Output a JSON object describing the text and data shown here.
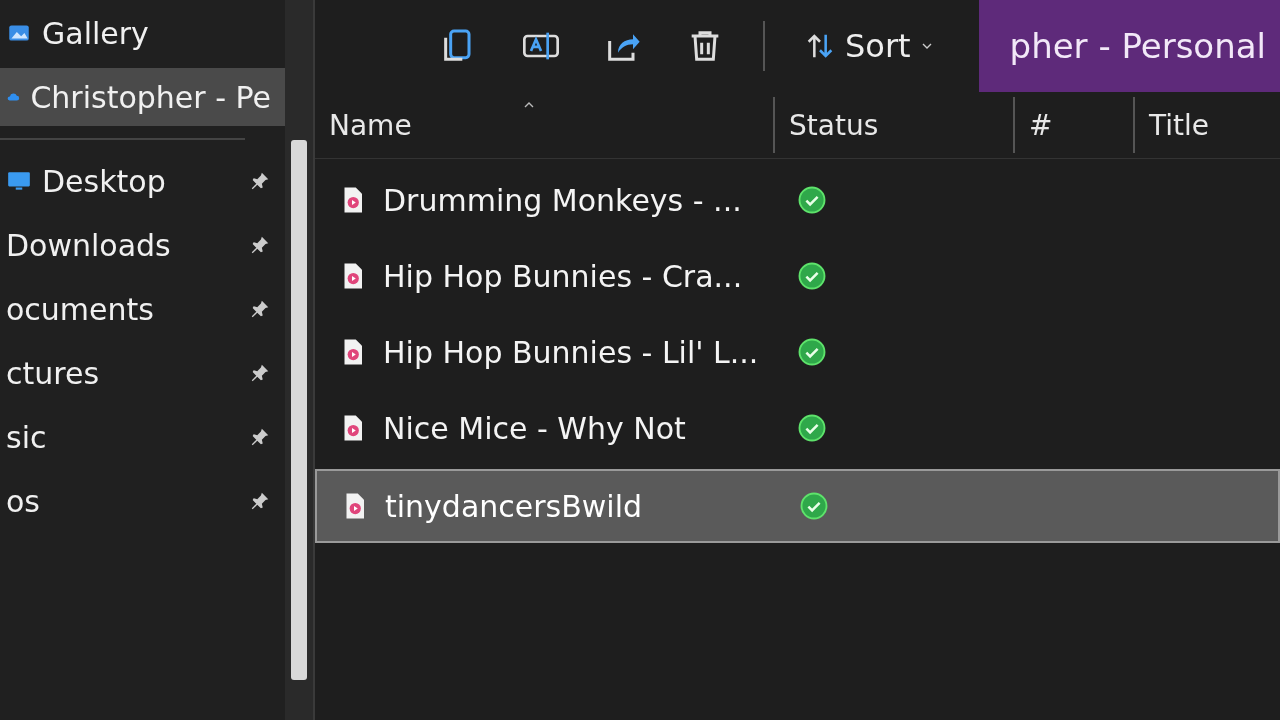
{
  "title_bar": {
    "title": "pher - Personal"
  },
  "sidebar": {
    "items": [
      {
        "label": "Gallery",
        "kind": "gallery",
        "pinned": false,
        "selected": false
      },
      {
        "label": "Christopher - Pe",
        "kind": "cloud",
        "pinned": false,
        "selected": true
      },
      {
        "kind": "separator"
      },
      {
        "label": "Desktop",
        "kind": "desktop",
        "pinned": true,
        "selected": false
      },
      {
        "label": "Downloads",
        "kind": "folder",
        "pinned": true,
        "selected": false
      },
      {
        "label": "ocuments",
        "kind": "folder",
        "pinned": true,
        "selected": false
      },
      {
        "label": "ctures",
        "kind": "folder",
        "pinned": true,
        "selected": false
      },
      {
        "label": "sic",
        "kind": "folder",
        "pinned": true,
        "selected": false
      },
      {
        "label": "os",
        "kind": "folder",
        "pinned": true,
        "selected": false
      }
    ]
  },
  "toolbar": {
    "buttons": [
      {
        "kind": "copy"
      },
      {
        "kind": "rename"
      },
      {
        "kind": "share"
      },
      {
        "kind": "delete"
      }
    ],
    "sort": {
      "label": "Sort"
    }
  },
  "table": {
    "columns": [
      {
        "label": "Name",
        "sorted": true
      },
      {
        "label": "Status",
        "sorted": false
      },
      {
        "label": "#",
        "sorted": false
      },
      {
        "label": "Title",
        "sorted": false
      }
    ],
    "rows": [
      {
        "name": "Drumming Monkeys - ...",
        "synced": true,
        "selected": false
      },
      {
        "name": "Hip Hop Bunnies - Cra...",
        "synced": true,
        "selected": false
      },
      {
        "name": "Hip Hop Bunnies - Lil' L...",
        "synced": true,
        "selected": false
      },
      {
        "name": "Nice Mice - Why Not",
        "synced": true,
        "selected": false
      },
      {
        "name": "tinydancersBwild",
        "synced": true,
        "selected": true
      }
    ]
  }
}
